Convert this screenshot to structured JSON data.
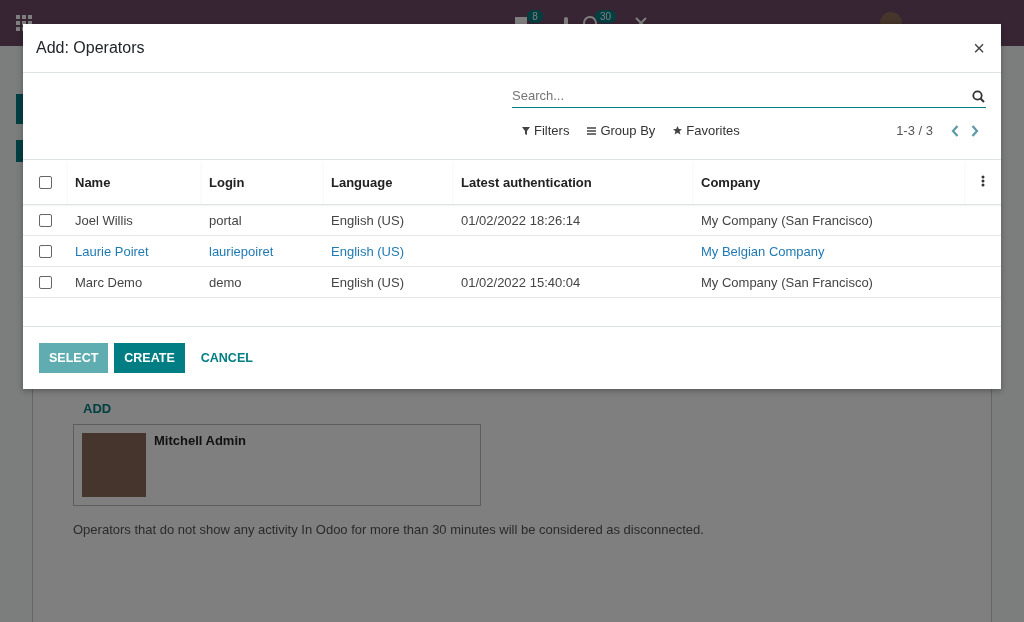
{
  "navbar": {
    "messages_badge": "8",
    "activities_badge": "30"
  },
  "background": {
    "add_button": "ADD",
    "operator_card": {
      "name": "Mitchell Admin"
    },
    "note": "Operators that do not show any activity In Odoo for more than 30 minutes will be considered as disconnected."
  },
  "dialog": {
    "title": "Add: Operators",
    "close": "×",
    "search": {
      "placeholder": "Search..."
    },
    "filters": [
      {
        "kind": "filter",
        "label": "Filters"
      },
      {
        "kind": "group",
        "label": "Group By"
      },
      {
        "kind": "favorite",
        "label": "Favorites"
      }
    ],
    "pager": "1-3 / 3",
    "table": {
      "select_all": {
        "checked": false
      },
      "columns": [
        "Name",
        "Login",
        "Language",
        "Latest authentication",
        "Company"
      ],
      "rows": [
        {
          "checked": false,
          "link": false,
          "cells": [
            "Joel Willis",
            "portal",
            "English (US)",
            "01/02/2022 18:26:14",
            "My Company (San Francisco)"
          ]
        },
        {
          "checked": false,
          "link": true,
          "cells": [
            "Laurie Poiret",
            "lauriepoiret",
            "English (US)",
            "",
            "My Belgian Company"
          ]
        },
        {
          "checked": false,
          "link": false,
          "cells": [
            "Marc Demo",
            "demo",
            "English (US)",
            "01/02/2022 15:40:04",
            "My Company (San Francisco)"
          ]
        }
      ]
    },
    "buttons": [
      {
        "kind": "primary-light",
        "label": "SELECT"
      },
      {
        "kind": "primary",
        "label": "CREATE"
      },
      {
        "kind": "link",
        "label": "CANCEL"
      }
    ]
  }
}
